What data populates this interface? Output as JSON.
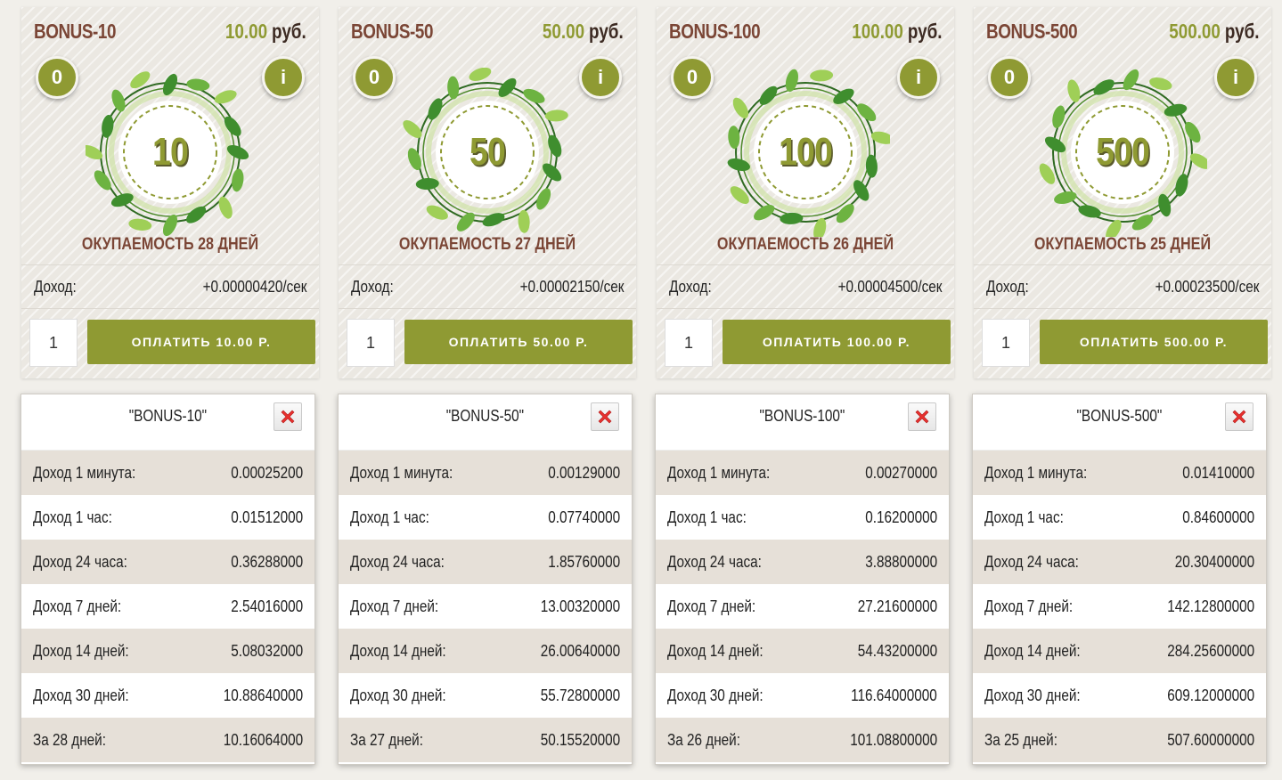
{
  "plans": [
    {
      "title": "BONUS-10",
      "price": "10.00",
      "currency": "руб.",
      "count_badge": "0",
      "info_badge": "i",
      "wreath_number": "10",
      "payback": "ОКУПАЕМОСТЬ 28 ДНЕЙ",
      "income_label": "Доход:",
      "income_value": "+0.00000420/сек",
      "quantity": "1",
      "pay_label": "ОПЛАТИТЬ 10.00 Р."
    },
    {
      "title": "BONUS-50",
      "price": "50.00",
      "currency": "руб.",
      "count_badge": "0",
      "info_badge": "i",
      "wreath_number": "50",
      "payback": "ОКУПАЕМОСТЬ 27 ДНЕЙ",
      "income_label": "Доход:",
      "income_value": "+0.00002150/сек",
      "quantity": "1",
      "pay_label": "ОПЛАТИТЬ 50.00 Р."
    },
    {
      "title": "BONUS-100",
      "price": "100.00",
      "currency": "руб.",
      "count_badge": "0",
      "info_badge": "i",
      "wreath_number": "100",
      "payback": "ОКУПАЕМОСТЬ 26 ДНЕЙ",
      "income_label": "Доход:",
      "income_value": "+0.00004500/сек",
      "quantity": "1",
      "pay_label": "ОПЛАТИТЬ 100.00 Р."
    },
    {
      "title": "BONUS-500",
      "price": "500.00",
      "currency": "руб.",
      "count_badge": "0",
      "info_badge": "i",
      "wreath_number": "500",
      "payback": "ОКУПАЕМОСТЬ 25 ДНЕЙ",
      "income_label": "Доход:",
      "income_value": "+0.00023500/сек",
      "quantity": "1",
      "pay_label": "ОПЛАТИТЬ 500.00 Р."
    }
  ],
  "popups": [
    {
      "title": "\"BONUS-10\"",
      "rows": [
        {
          "label": "Доход 1 минута:",
          "value": "0.00025200"
        },
        {
          "label": "Доход 1 час:",
          "value": "0.01512000"
        },
        {
          "label": "Доход 24 часа:",
          "value": "0.36288000"
        },
        {
          "label": "Доход 7 дней:",
          "value": "2.54016000"
        },
        {
          "label": "Доход 14 дней:",
          "value": "5.08032000"
        },
        {
          "label": "Доход 30 дней:",
          "value": "10.88640000"
        },
        {
          "label": "За 28 дней:",
          "value": "10.16064000"
        }
      ]
    },
    {
      "title": "\"BONUS-50\"",
      "rows": [
        {
          "label": "Доход 1 минута:",
          "value": "0.00129000"
        },
        {
          "label": "Доход 1 час:",
          "value": "0.07740000"
        },
        {
          "label": "Доход 24 часа:",
          "value": "1.85760000"
        },
        {
          "label": "Доход 7 дней:",
          "value": "13.00320000"
        },
        {
          "label": "Доход 14 дней:",
          "value": "26.00640000"
        },
        {
          "label": "Доход 30 дней:",
          "value": "55.72800000"
        },
        {
          "label": "За 27 дней:",
          "value": "50.15520000"
        }
      ]
    },
    {
      "title": "\"BONUS-100\"",
      "rows": [
        {
          "label": "Доход 1 минута:",
          "value": "0.00270000"
        },
        {
          "label": "Доход 1 час:",
          "value": "0.16200000"
        },
        {
          "label": "Доход 24 часа:",
          "value": "3.88800000"
        },
        {
          "label": "Доход 7 дней:",
          "value": "27.21600000"
        },
        {
          "label": "Доход 14 дней:",
          "value": "54.43200000"
        },
        {
          "label": "Доход 30 дней:",
          "value": "116.64000000"
        },
        {
          "label": "За 26 дней:",
          "value": "101.08800000"
        }
      ]
    },
    {
      "title": "\"BONUS-500\"",
      "rows": [
        {
          "label": "Доход 1 минута:",
          "value": "0.01410000"
        },
        {
          "label": "Доход 1 час:",
          "value": "0.84600000"
        },
        {
          "label": "Доход 24 часа:",
          "value": "20.30400000"
        },
        {
          "label": "Доход 7 дней:",
          "value": "142.12800000"
        },
        {
          "label": "Доход 14 дней:",
          "value": "284.25600000"
        },
        {
          "label": "Доход 30 дней:",
          "value": "609.12000000"
        },
        {
          "label": "За 25 дней:",
          "value": "507.60000000"
        }
      ]
    }
  ],
  "colors": {
    "accent": "#8f9a33",
    "title_brown": "#7b4636",
    "row_shade": "#e6e0d8",
    "close_red": "#e8302e"
  },
  "icons": {
    "close": "close-x-icon",
    "wreath": "leaf-wreath-icon"
  }
}
